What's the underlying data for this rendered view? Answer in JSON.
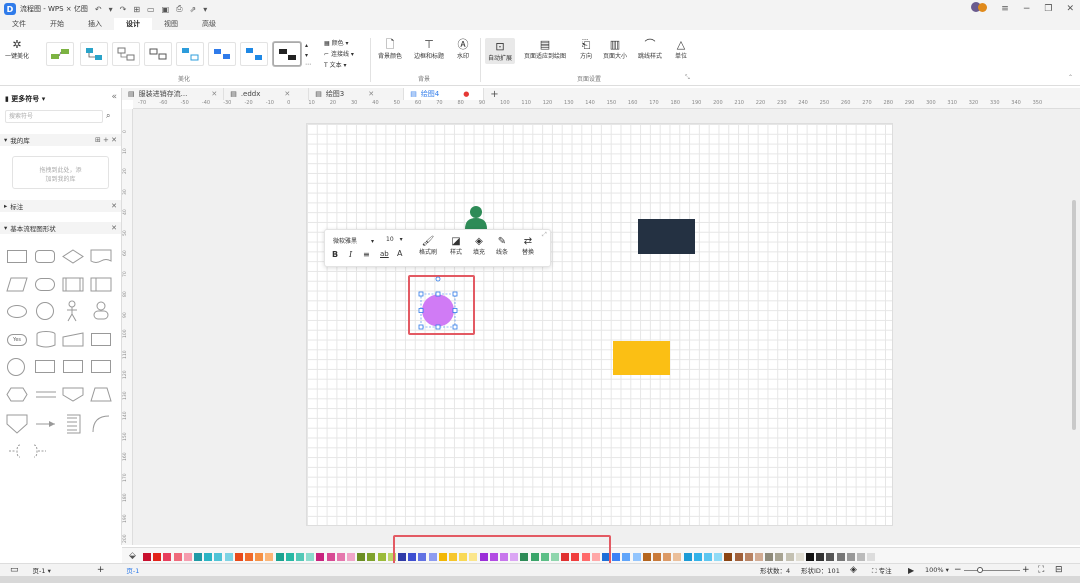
{
  "window": {
    "title": "流程图 - WPS × 亿图",
    "controls": [
      "minimize",
      "maximize",
      "close"
    ]
  },
  "menu": {
    "tabs": [
      "文件",
      "开始",
      "插入",
      "设计",
      "视图",
      "高级"
    ],
    "active": "设计"
  },
  "ribbon": {
    "beautify_label": "一键美化",
    "group_beautify": "美化",
    "group_background": "背景",
    "group_page_setup": "页面设置",
    "theme_options": [
      "颜色",
      "连接线",
      "文本"
    ],
    "buttons": {
      "bg_color": "背景颜色",
      "border_title": "边框和标题",
      "watermark": "水印",
      "auto_expand": "自动扩展",
      "fit_page": "页面适应到绘图",
      "direction": "方向",
      "page_size": "页面大小",
      "jump_style": "跳线样式",
      "unit": "单位"
    }
  },
  "doc_tabs": [
    {
      "label": "服装进销存流..."
    },
    {
      "label": ".eddx"
    },
    {
      "label": "绘图3"
    },
    {
      "label": "绘图4"
    }
  ],
  "ruler": {
    "top": [
      "-70",
      "-60",
      "-50",
      "-40",
      "-30",
      "-20",
      "-10",
      "0",
      "10",
      "20",
      "30",
      "40",
      "50",
      "60",
      "70",
      "80",
      "90",
      "100",
      "110",
      "120",
      "130",
      "140",
      "150",
      "160",
      "170",
      "180",
      "190",
      "200",
      "210",
      "220",
      "230",
      "240",
      "250",
      "260",
      "270",
      "280",
      "290",
      "300",
      "310",
      "320",
      "330",
      "340",
      "350"
    ],
    "left": [
      "0",
      "10",
      "20",
      "30",
      "40",
      "50",
      "60",
      "70",
      "80",
      "90",
      "100",
      "110",
      "120",
      "130",
      "140",
      "150",
      "160",
      "170",
      "180",
      "190",
      "200"
    ]
  },
  "left_panel": {
    "title": "更多符号",
    "search_placeholder": "搜索符号",
    "my_library": "我的库",
    "drop_hint_line1": "拖拽到此处，添",
    "drop_hint_line2": "加到我的库",
    "annotations": "标注",
    "basic_flow": "基本流程图形状",
    "yes_label": "Yes"
  },
  "float_toolbar": {
    "font": "微软雅黑",
    "size": "10",
    "format_brush": "格式刷",
    "style": "样式",
    "fill": "填充",
    "line": "线条",
    "replace": "替换"
  },
  "colors": {
    "accent": "#2f7bea",
    "person": "#2e8b57",
    "dark_rect": "#243142",
    "circle": "#d07bf5",
    "yellow_rect": "#fbbf14",
    "highlight": "#e35a63"
  },
  "palette": [
    "#c8102e",
    "#e2231a",
    "#e83e5c",
    "#ef6a7b",
    "#f59cae",
    "#1f9aa6",
    "#2bb4c4",
    "#4fc3d6",
    "#7dd3e4",
    "#e84a1b",
    "#f06a2a",
    "#f59145",
    "#fbb577",
    "#1aa390",
    "#28b9a4",
    "#53c8b6",
    "#8cdccd",
    "#c9237e",
    "#d84b94",
    "#e577ad",
    "#f0a5c8",
    "#6b8e23",
    "#7fa22d",
    "#9bbb3a",
    "#bdd56b",
    "#2f3aa8",
    "#3e4fd1",
    "#6272e3",
    "#8e9cf0",
    "#f2b705",
    "#f6c62d",
    "#f9d957",
    "#fbe68c",
    "#9b2fd8",
    "#b24ce3",
    "#c776ec",
    "#dba6f4",
    "#2e8b57",
    "#3aa56a",
    "#5cbf87",
    "#8fd6ad",
    "#e03131",
    "#f03e3e",
    "#ff6b6b",
    "#ffa8a8",
    "#1e6fd9",
    "#3b82f6",
    "#60a5fa",
    "#93c5fd",
    "#b5651d",
    "#c97a3a",
    "#dc9a66",
    "#ebbf9a",
    "#1c9bd6",
    "#33b2e8",
    "#5cc6f0",
    "#90dbf6",
    "#8b4513",
    "#a0603a",
    "#b88363",
    "#d1ab93",
    "#8e8a7a",
    "#a8a493",
    "#c4c1b2",
    "#e0ddd2",
    "#111111",
    "#333333",
    "#555555",
    "#777777",
    "#999999",
    "#bbbbbb",
    "#dddddd"
  ],
  "status": {
    "page": "页-1",
    "page_tab": "页-1",
    "shape_count": "形状数：4",
    "shape_id": "形状ID：101",
    "focus": "专注",
    "zoom": "100%"
  }
}
